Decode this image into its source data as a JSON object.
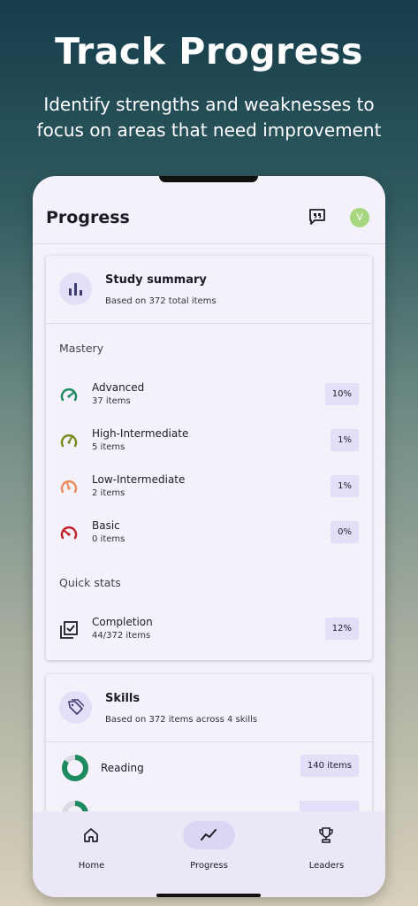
{
  "promo": {
    "title": "Track Progress",
    "subtitle_line1": "Identify strengths and weaknesses to",
    "subtitle_line2": "focus on areas that need improvement"
  },
  "header": {
    "title": "Progress",
    "avatar_initial": "V",
    "feedback_icon": "feedback-quote-icon"
  },
  "study_summary": {
    "title": "Study summary",
    "subtitle": "Based on 372 total items",
    "icon": "bar-chart-icon",
    "mastery_label": "Mastery",
    "mastery": [
      {
        "name": "Advanced",
        "count": "37 items",
        "percent": "10%",
        "color": "#1e8a5f",
        "icon": "gauge-high-icon"
      },
      {
        "name": "High-Intermediate",
        "count": "5 items",
        "percent": "1%",
        "color": "#7a8a1e",
        "icon": "gauge-mid-high-icon"
      },
      {
        "name": "Low-Intermediate",
        "count": "2 items",
        "percent": "1%",
        "color": "#f08a5d",
        "icon": "gauge-mid-low-icon"
      },
      {
        "name": "Basic",
        "count": "0 items",
        "percent": "0%",
        "color": "#c0202a",
        "icon": "gauge-low-icon"
      }
    ],
    "quick_stats_label": "Quick stats",
    "completion": {
      "name": "Completion",
      "count": "44/372 items",
      "percent": "12%",
      "icon": "checklist-icon"
    }
  },
  "skills": {
    "title": "Skills",
    "subtitle": "Based on 372 items across 4 skills",
    "icon": "tag-icon",
    "items": [
      {
        "name": "Reading",
        "count": "140 items",
        "color": "#1e8a5f"
      },
      {
        "name": "",
        "count": "",
        "color": "#1e8a5f"
      }
    ]
  },
  "nav": {
    "items": [
      {
        "label": "Home",
        "icon": "home-icon",
        "active": false
      },
      {
        "label": "Progress",
        "icon": "trend-icon",
        "active": true
      },
      {
        "label": "Leaders",
        "icon": "trophy-icon",
        "active": false
      }
    ]
  }
}
